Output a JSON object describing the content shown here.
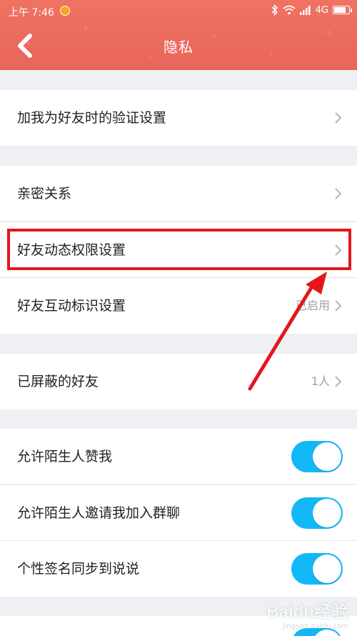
{
  "status_bar": {
    "time": "上午 7:46",
    "network": "4G"
  },
  "nav": {
    "title": "隐私"
  },
  "sections": {
    "verify": {
      "label": "加我为好友时的验证设置"
    },
    "intimate": {
      "label": "亲密关系"
    },
    "feed_permission": {
      "label": "好友动态权限设置"
    },
    "interaction_mark": {
      "label": "好友互动标识设置",
      "value": "已启用"
    },
    "blocked": {
      "label": "已屏蔽的好友",
      "value": "1人"
    },
    "allow_like": {
      "label": "允许陌生人赞我",
      "on": true
    },
    "allow_group_invite": {
      "label": "允许陌生人邀请我加入群聊",
      "on": true
    },
    "signature_sync": {
      "label": "个性签名同步到说说",
      "on": true
    }
  },
  "colors": {
    "header": "#ea6c5e",
    "toggle_on": "#12b7f5",
    "highlight": "#e4161c"
  },
  "watermark": {
    "logo": "Baidu经验",
    "sub": "jingyan.baidu.com"
  }
}
